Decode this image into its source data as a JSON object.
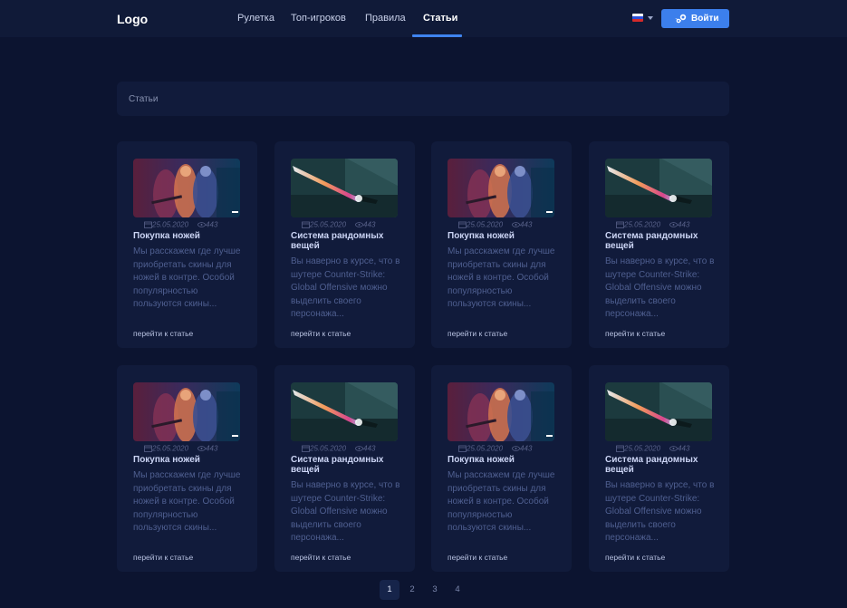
{
  "header": {
    "logo": "Logo",
    "nav": [
      {
        "label": "Рулетка",
        "active": false
      },
      {
        "label": "Топ-игроков",
        "active": false
      },
      {
        "label": "Правила",
        "active": false
      },
      {
        "label": "Статьи",
        "active": true
      }
    ],
    "language_icon": "russian-flag-icon",
    "login_label": "Войти",
    "login_icon": "steam-icon"
  },
  "breadcrumb": {
    "label": "Статьи"
  },
  "articles": [
    {
      "image": "knife-players-image",
      "date": "25.05.2020",
      "views": "443",
      "title": "Покупка ножей",
      "desc": "Мы расскажем где лучше приобретать скины для ножей в контре. Особой популярностью пользуются скины...",
      "link": "перейти к статье"
    },
    {
      "image": "knife-closeup-image",
      "date": "25.05.2020",
      "views": "443",
      "title": "Система рандомных вещей",
      "desc": "Вы наверно в курсе, что в шутере Counter-Strike: Global Offensive можно выделить своего персонажа...",
      "link": "перейти к статье"
    },
    {
      "image": "knife-players-image",
      "date": "25.05.2020",
      "views": "443",
      "title": "Покупка ножей",
      "desc": "Мы расскажем где лучше приобретать скины для ножей в контре. Особой популярностью пользуются скины...",
      "link": "перейти к статье"
    },
    {
      "image": "knife-closeup-image",
      "date": "25.05.2020",
      "views": "443",
      "title": "Система рандомных вещей",
      "desc": "Вы наверно в курсе, что в шутере Counter-Strike: Global Offensive можно выделить своего персонажа...",
      "link": "перейти к статье"
    },
    {
      "image": "knife-players-image",
      "date": "25.05.2020",
      "views": "443",
      "title": "Покупка ножей",
      "desc": "Мы расскажем где лучше приобретать скины для ножей в контре. Особой популярностью пользуются скины...",
      "link": "перейти к статье"
    },
    {
      "image": "knife-closeup-image",
      "date": "25.05.2020",
      "views": "443",
      "title": "Система рандомных вещей",
      "desc": "Вы наверно в курсе, что в шутере Counter-Strike: Global Offensive можно выделить своего персонажа...",
      "link": "перейти к статье"
    },
    {
      "image": "knife-players-image",
      "date": "25.05.2020",
      "views": "443",
      "title": "Покупка ножей",
      "desc": "Мы расскажем где лучше приобретать скины для ножей в контре. Особой популярностью пользуются скины...",
      "link": "перейти к статье"
    },
    {
      "image": "knife-closeup-image",
      "date": "25.05.2020",
      "views": "443",
      "title": "Система рандомных вещей",
      "desc": "Вы наверно в курсе, что в шутере Counter-Strike: Global Offensive можно выделить своего персонажа...",
      "link": "перейти к статье"
    }
  ],
  "pagination": {
    "pages": [
      "1",
      "2",
      "3",
      "4"
    ],
    "current": "1"
  },
  "colors": {
    "background": "#0c1430",
    "header": "#101a38",
    "card": "#111b3b",
    "accent": "#3c7fec"
  }
}
